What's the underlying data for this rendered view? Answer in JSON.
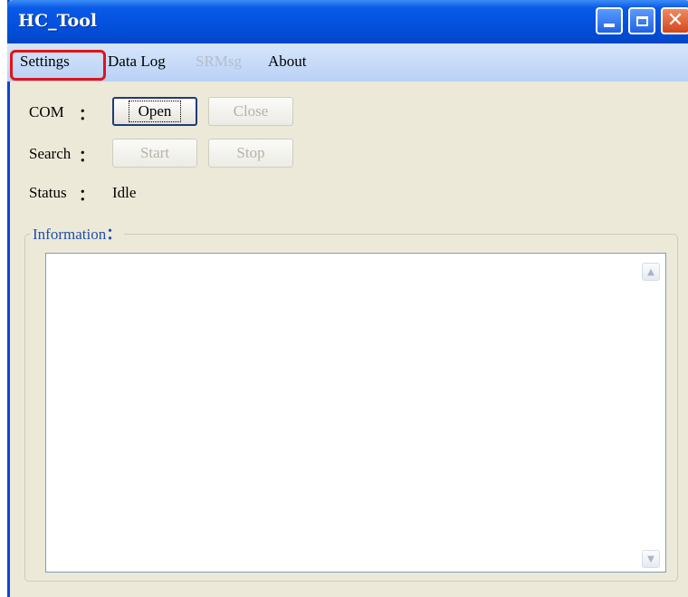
{
  "window": {
    "title": "HC_Tool",
    "controls": {
      "minimize": "minimize-icon",
      "maximize": "maximize-icon",
      "close": "close-icon"
    }
  },
  "menu": {
    "items": [
      {
        "label": "Settings",
        "enabled": true,
        "highlighted": true
      },
      {
        "label": "Data Log",
        "enabled": true
      },
      {
        "label": "SRMsg",
        "enabled": false
      },
      {
        "label": "About",
        "enabled": true
      }
    ]
  },
  "com": {
    "label": "COM",
    "colon": "：",
    "open_button": "Open",
    "close_button": "Close"
  },
  "search": {
    "label": "Search",
    "colon": "：",
    "start_button": "Start",
    "stop_button": "Stop"
  },
  "status": {
    "label": "Status",
    "colon": "：",
    "value": "Idle"
  },
  "information": {
    "label": "Information",
    "colon": "：",
    "content": ""
  },
  "colors": {
    "titlebar": "#0350dd",
    "menubar": "#c7dbf7",
    "window_bg": "#ece9d8",
    "highlight_box": "#e0141a",
    "group_label": "#1f4fa8"
  }
}
